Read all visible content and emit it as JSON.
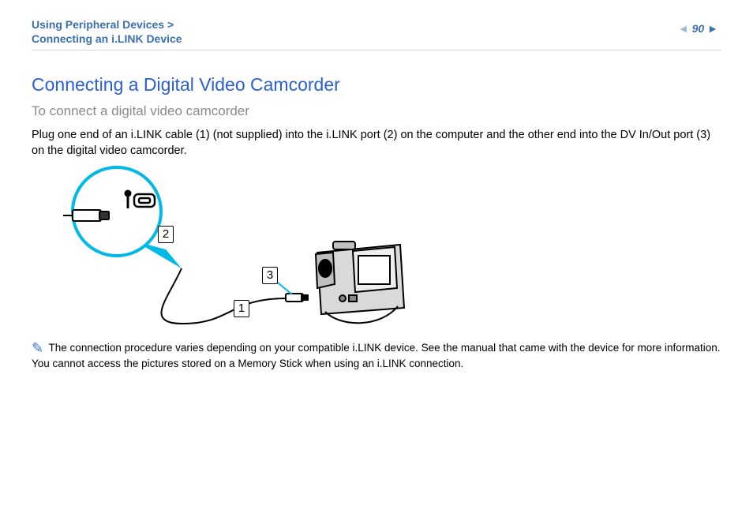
{
  "breadcrumb": {
    "line1": "Using Peripheral Devices >",
    "line2": "Connecting an i.LINK Device"
  },
  "page_number": "90",
  "section_title": "Connecting a Digital Video Camcorder",
  "subheading": "To connect a digital video camcorder",
  "body_paragraph": "Plug one end of an i.LINK cable (1) (not supplied) into the i.LINK port (2) on the computer and the other end into the DV In/Out port (3) on the digital video camcorder.",
  "note1": "The connection procedure varies depending on your compatible i.LINK device. See the manual that came with the device for more information.",
  "note2": "You cannot access the pictures stored on a Memory Stick when using an i.LINK connection.",
  "callouts": {
    "c1": "1",
    "c2": "2",
    "c3": "3"
  }
}
